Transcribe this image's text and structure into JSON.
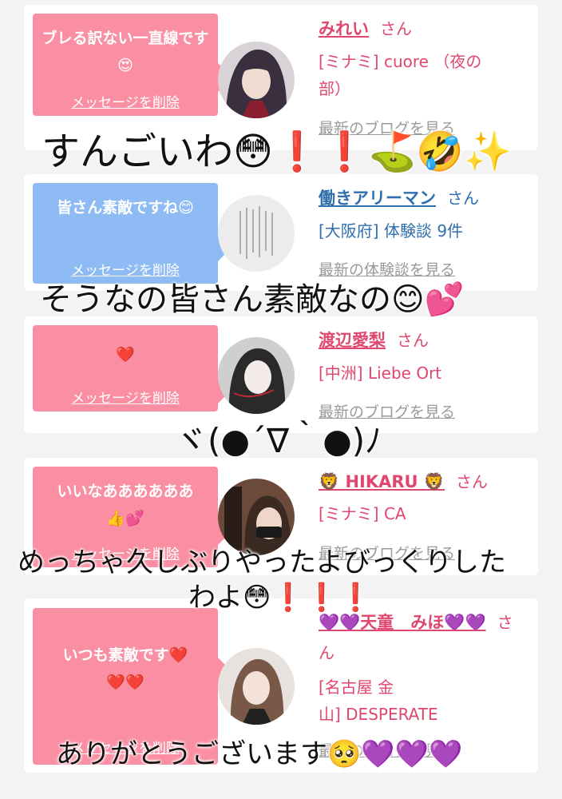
{
  "cards": [
    {
      "message": "ブレる訳ない一直線です😍",
      "delete_label": "メッセージを削除",
      "user_name": "みれい",
      "honorific": "さん",
      "shop_line1": "[ミナミ] cuore （夜の",
      "shop_line2": "部）",
      "link": "最新のブログを見る",
      "avatar_icon": "avatar-photo-icon"
    },
    {
      "message": "皆さん素敵ですね😊",
      "delete_label": "メッセージを削除",
      "user_name": "働きアリーマン",
      "honorific": "さん",
      "shop_line1": "[大阪府] 体験談 9件",
      "link": "最新の体験談を見る",
      "avatar_icon": "avatar-photo-icon"
    },
    {
      "message": "❤️",
      "delete_label": "メッセージを削除",
      "user_name": "渡辺愛梨",
      "honorific": "さん",
      "shop_line1": "[中洲] Liebe Ort",
      "link": "最新のブログを見る",
      "avatar_icon": "avatar-photo-icon"
    },
    {
      "message": "いいなああああああ👍💕",
      "delete_label": "メッセージを削除",
      "user_name": "🦁 HIKARU 🦁",
      "honorific": "さん",
      "shop_line1": "[ミナミ] CA",
      "link": "最新のブログを見る",
      "avatar_icon": "avatar-photo-icon"
    },
    {
      "message": "いつも素敵です❤️❤️❤️",
      "delete_label": "メッセージを削除",
      "user_name": "💜💜天童　みほ💜💜",
      "honorific": "さん",
      "shop_line1": "[名古屋 金",
      "shop_line2": "山] DESPERATE",
      "link": "最新のブログを見る",
      "avatar_icon": "avatar-photo-icon"
    }
  ],
  "overlays": {
    "o1": "すんごいわ😳❗️❗️⛳️🤣✨",
    "o2": "そうなの皆さん素敵なの😊💕",
    "o3": "ヾ(●´∇｀●)ﾉ",
    "o4a": "めっちゃ久しぶりやったよびっくりした",
    "o4b": "わよ😳❗️❗️❗️",
    "o5": "ありがとうございます🥺💜💜💜"
  },
  "colors": {
    "pink_bubble": "#fa8fa3",
    "blue_bubble": "#8ebbf4",
    "pink_text": "#e0476e",
    "blue_text": "#2f6fae"
  }
}
